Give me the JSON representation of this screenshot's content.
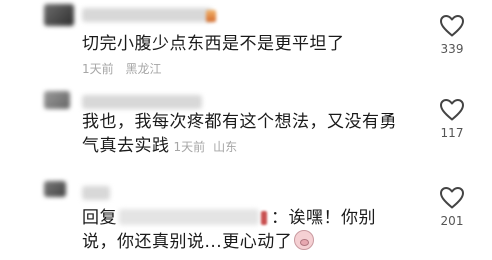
{
  "comments": [
    {
      "text": "切完小腹少点东西是不是更平坦了",
      "time": "1天前",
      "location": "黑龙江",
      "likes": "339"
    },
    {
      "text_line1": "我也，我每次疼都有这个想法，又没有勇",
      "text_line2": "气真去实践",
      "time": "1天前",
      "location": "山东",
      "likes": "117"
    },
    {
      "reply_prefix": "回复",
      "reply_after_mention": "：诶嘿！你别",
      "text_line2": "说，你还真别说...更心动了",
      "likes": "201",
      "emoji": "pig-face-icon"
    }
  ],
  "icons": {
    "like": "heart-outline-icon"
  }
}
